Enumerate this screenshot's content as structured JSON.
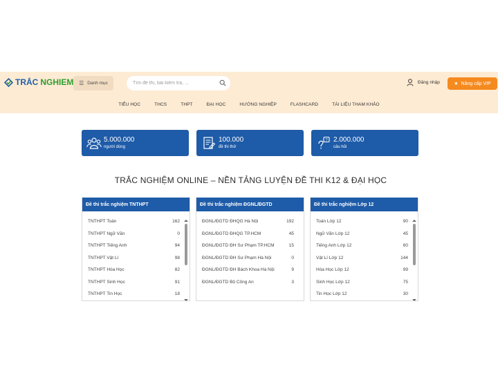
{
  "header": {
    "logo_part1": "TRẮC",
    "logo_part2": "NGHIEM",
    "menu_label": "Danh mục",
    "search_placeholder": "Tìm đề thi, bài kiểm tra, ...",
    "login_label": "Đăng nhập",
    "vip_label": "Nâng cấp VIP"
  },
  "nav": {
    "items": [
      "TIỂU HỌC",
      "THCS",
      "THPT",
      "ĐẠI HỌC",
      "HƯỚNG NGHIỆP",
      "FLASHCARD",
      "TÀI LIỆU THAM KHẢO"
    ]
  },
  "stats": [
    {
      "value": "5.000.000",
      "label": "người dùng",
      "icon": "users-icon"
    },
    {
      "value": "100.000",
      "label": "đề thi thử",
      "icon": "exam-icon"
    },
    {
      "value": "2.000.000",
      "label": "câu hỏi",
      "icon": "question-icon"
    }
  ],
  "main_title": "TRẮC NGHIỆM ONLINE – NỀN TẢNG LUYỆN ĐỀ THI K12 & ĐẠI HỌC",
  "panels": [
    {
      "title": "Đề thi trắc nghiệm TNTHPT",
      "rows": [
        {
          "name": "TNTHPT Toán",
          "count": "162"
        },
        {
          "name": "TNTHPT Ngữ Văn",
          "count": "0"
        },
        {
          "name": "TNTHPT Tiếng Anh",
          "count": "94"
        },
        {
          "name": "TNTHPT Vật Lí",
          "count": "98"
        },
        {
          "name": "TNTHPT Hóa Học",
          "count": "82"
        },
        {
          "name": "TNTHPT Sinh Học",
          "count": "91"
        },
        {
          "name": "TNTHPT Tin Học",
          "count": "18"
        }
      ],
      "scroll": true
    },
    {
      "title": "Đề thi trắc nghiệm ĐGNL/ĐGTD",
      "rows": [
        {
          "name": "ĐGNL/ĐGTD ĐHQG Hà Nội",
          "count": "192"
        },
        {
          "name": "ĐGNL/ĐGTD ĐHQG TP.HCM",
          "count": "45"
        },
        {
          "name": "ĐGNL/ĐGTD ĐH Sư Phạm TP.HCM",
          "count": "15"
        },
        {
          "name": "ĐGNL/ĐGTD ĐH Sư Phạm Hà Nội",
          "count": "0"
        },
        {
          "name": "ĐGNL/ĐGTD ĐH Bách Khoa Hà Nội",
          "count": "9"
        },
        {
          "name": "ĐGNL/ĐGTD Bộ Công An",
          "count": "3"
        }
      ],
      "scroll": false
    },
    {
      "title": "Đề thi trắc nghiệm Lớp 12",
      "rows": [
        {
          "name": "Toán Lớp 12",
          "count": "90"
        },
        {
          "name": "Ngữ Văn Lớp 12",
          "count": "45"
        },
        {
          "name": "Tiếng Anh Lớp 12",
          "count": "60"
        },
        {
          "name": "Vật Lí Lớp 12",
          "count": "144"
        },
        {
          "name": "Hóa Học Lớp 12",
          "count": "99"
        },
        {
          "name": "Sinh Học Lớp 12",
          "count": "75"
        },
        {
          "name": "Tin Học Lớp 12",
          "count": "30"
        }
      ],
      "scroll": true
    }
  ],
  "colors": {
    "brand_blue": "#1e5ba8",
    "brand_green": "#2e9e2e",
    "header_bg": "#fdebd3",
    "vip_orange": "#f58a1f"
  }
}
